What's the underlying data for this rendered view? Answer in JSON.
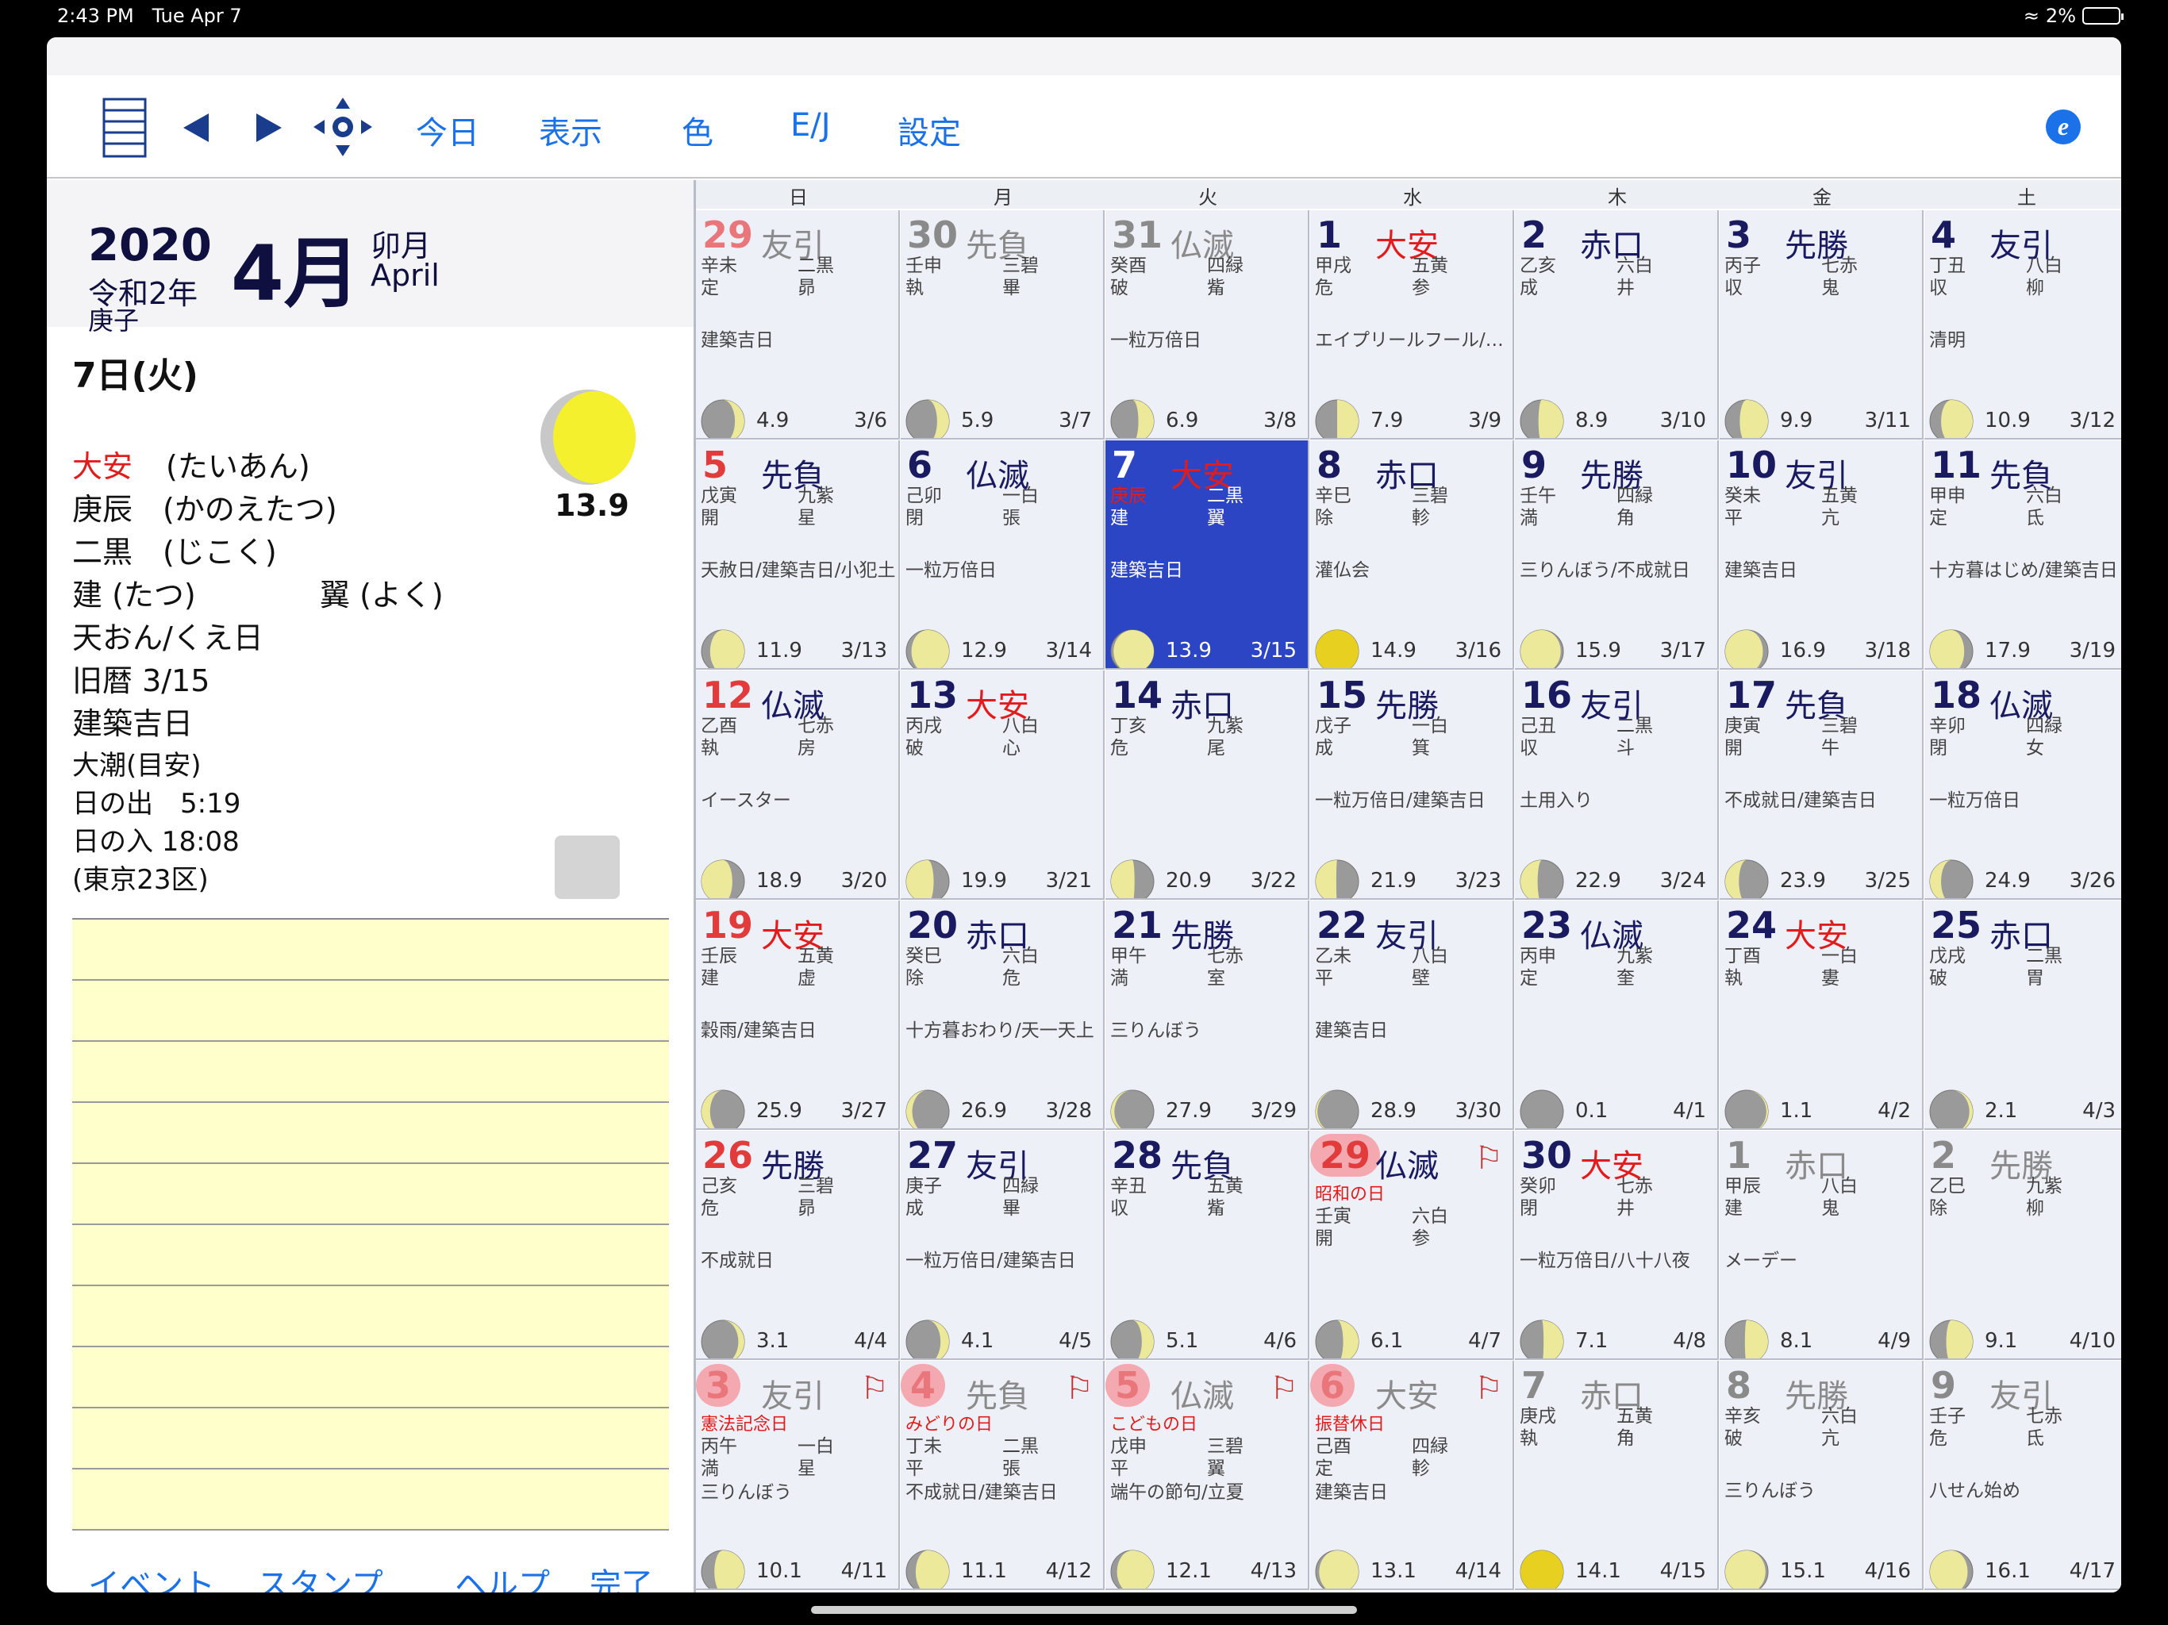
{
  "status": {
    "time": "2:43 PM",
    "date": "Tue Apr 7",
    "battery": "2%"
  },
  "toolbar": {
    "today": "今日",
    "view": "表示",
    "color": "色",
    "ej": "E/J",
    "settings": "設定"
  },
  "header": {
    "year": "2020",
    "reiwa": "令和2年",
    "eto": "庚子",
    "month_num": "4月",
    "month_kan": "卯月",
    "month_eng": "April"
  },
  "detail": {
    "date": "7日(火)",
    "rokuyo": "大安",
    "rokuyo_reading": "(たいあん)",
    "kanshi": "庚辰　(かのえたつ)",
    "kyusei": "二黒　(じこく)",
    "choku": "建 (たつ)",
    "shuku": "翼 (よく)",
    "day_note": "天おん/くえ日",
    "lunar": "旧暦 3/15",
    "kichi": "建築吉日",
    "tide": "大潮(目安)",
    "sunrise": "日の出　5:19",
    "sunset": "日の入 18:08",
    "location": "(東京23区)",
    "moon_age": "13.9"
  },
  "bottom": {
    "event": "イベント",
    "stamp": "スタンプ",
    "help": "ヘルプ",
    "done": "完了"
  },
  "weekdays": [
    "日",
    "月",
    "火",
    "水",
    "木",
    "金",
    "土"
  ],
  "cells": [
    {
      "d": "29",
      "k": "友引",
      "a": "辛未",
      "b": "二黒",
      "c": "定",
      "e": "昴",
      "ev": "建築吉日",
      "age": "4.9",
      "lun": "3/6",
      "o": 1,
      "p": 0.22
    },
    {
      "d": "30",
      "k": "先負",
      "a": "壬申",
      "b": "三碧",
      "c": "執",
      "e": "畢",
      "ev": "",
      "age": "5.9",
      "lun": "3/7",
      "o": 1,
      "p": 0.28
    },
    {
      "d": "31",
      "k": "仏滅",
      "a": "癸酉",
      "b": "四緑",
      "c": "破",
      "e": "觜",
      "ev": "一粒万倍日",
      "age": "6.9",
      "lun": "3/8",
      "o": 1,
      "p": 0.36
    },
    {
      "d": "1",
      "k": "大安",
      "kr": 1,
      "a": "甲戌",
      "b": "五黄",
      "c": "危",
      "e": "参",
      "ev": "エイプリールフール/一粒万倍日",
      "age": "7.9",
      "lun": "3/9",
      "p": 0.5
    },
    {
      "d": "2",
      "k": "赤口",
      "a": "乙亥",
      "b": "六白",
      "c": "成",
      "e": "井",
      "ev": "",
      "age": "8.9",
      "lun": "3/10",
      "p": 0.58
    },
    {
      "d": "3",
      "k": "先勝",
      "a": "丙子",
      "b": "七赤",
      "c": "収",
      "e": "鬼",
      "ev": "",
      "age": "9.9",
      "lun": "3/11",
      "p": 0.66
    },
    {
      "d": "4",
      "k": "友引",
      "a": "丁丑",
      "b": "八白",
      "c": "収",
      "e": "柳",
      "ev": "清明",
      "age": "10.9",
      "lun": "3/12",
      "p": 0.74
    },
    {
      "d": "5",
      "k": "先負",
      "a": "戊寅",
      "b": "九紫",
      "c": "開",
      "e": "星",
      "ev": "天赦日/建築吉日/小犯土",
      "age": "11.9",
      "lun": "3/13",
      "p": 0.8
    },
    {
      "d": "6",
      "k": "仏滅",
      "a": "己卯",
      "b": "一白",
      "c": "閉",
      "e": "張",
      "ev": "一粒万倍日",
      "age": "12.9",
      "lun": "3/14",
      "p": 0.88
    },
    {
      "d": "7",
      "k": "大安",
      "kr": 1,
      "a": "庚辰",
      "b": "二黒",
      "c": "建",
      "e": "翼",
      "ev": "建築吉日",
      "age": "13.9",
      "lun": "3/15",
      "sel": 1,
      "p": 0.94
    },
    {
      "d": "8",
      "k": "赤口",
      "a": "辛巳",
      "b": "三碧",
      "c": "除",
      "e": "軫",
      "ev": "灌仏会",
      "age": "14.9",
      "lun": "3/16",
      "p": 1.0
    },
    {
      "d": "9",
      "k": "先勝",
      "a": "壬午",
      "b": "四緑",
      "c": "満",
      "e": "角",
      "ev": "三りんぼう/不成就日",
      "age": "15.9",
      "lun": "3/17",
      "p": 0.94,
      "w": 1
    },
    {
      "d": "10",
      "k": "友引",
      "a": "癸未",
      "b": "五黄",
      "c": "平",
      "e": "亢",
      "ev": "建築吉日",
      "age": "16.9",
      "lun": "3/18",
      "p": 0.88,
      "w": 1
    },
    {
      "d": "11",
      "k": "先負",
      "a": "甲申",
      "b": "六白",
      "c": "定",
      "e": "氐",
      "ev": "十方暮はじめ/建築吉日",
      "age": "17.9",
      "lun": "3/19",
      "p": 0.8,
      "w": 1
    },
    {
      "d": "12",
      "k": "仏滅",
      "a": "乙酉",
      "b": "七赤",
      "c": "執",
      "e": "房",
      "ev": "イースター",
      "age": "18.9",
      "lun": "3/20",
      "p": 0.72,
      "w": 1
    },
    {
      "d": "13",
      "k": "大安",
      "kr": 1,
      "a": "丙戌",
      "b": "八白",
      "c": "破",
      "e": "心",
      "ev": "",
      "age": "19.9",
      "lun": "3/21",
      "p": 0.64,
      "w": 1
    },
    {
      "d": "14",
      "k": "赤口",
      "a": "丁亥",
      "b": "九紫",
      "c": "危",
      "e": "尾",
      "ev": "",
      "age": "20.9",
      "lun": "3/22",
      "p": 0.55,
      "w": 1
    },
    {
      "d": "15",
      "k": "先勝",
      "a": "戊子",
      "b": "一白",
      "c": "成",
      "e": "箕",
      "ev": "一粒万倍日/建築吉日",
      "age": "21.9",
      "lun": "3/23",
      "p": 0.48,
      "w": 1
    },
    {
      "d": "16",
      "k": "友引",
      "a": "己丑",
      "b": "二黒",
      "c": "収",
      "e": "斗",
      "ev": "土用入り",
      "age": "22.9",
      "lun": "3/24",
      "p": 0.4,
      "w": 1
    },
    {
      "d": "17",
      "k": "先負",
      "a": "庚寅",
      "b": "三碧",
      "c": "開",
      "e": "牛",
      "ev": "不成就日/建築吉日",
      "age": "23.9",
      "lun": "3/25",
      "p": 0.32,
      "w": 1
    },
    {
      "d": "18",
      "k": "仏滅",
      "a": "辛卯",
      "b": "四緑",
      "c": "閉",
      "e": "女",
      "ev": "一粒万倍日",
      "age": "24.9",
      "lun": "3/26",
      "p": 0.26,
      "w": 1
    },
    {
      "d": "19",
      "k": "大安",
      "kr": 1,
      "a": "壬辰",
      "b": "五黄",
      "c": "建",
      "e": "虚",
      "ev": "穀雨/建築吉日",
      "age": "25.9",
      "lun": "3/27",
      "p": 0.2,
      "w": 1
    },
    {
      "d": "20",
      "k": "赤口",
      "a": "癸巳",
      "b": "六白",
      "c": "除",
      "e": "危",
      "ev": "十方暮おわり/天一天上",
      "age": "26.9",
      "lun": "3/28",
      "p": 0.14,
      "w": 1
    },
    {
      "d": "21",
      "k": "先勝",
      "a": "甲午",
      "b": "七赤",
      "c": "満",
      "e": "室",
      "ev": "三りんぼう",
      "age": "27.9",
      "lun": "3/29",
      "p": 0.08,
      "w": 1
    },
    {
      "d": "22",
      "k": "友引",
      "a": "乙未",
      "b": "八白",
      "c": "平",
      "e": "壁",
      "ev": "建築吉日",
      "age": "28.9",
      "lun": "3/30",
      "p": 0.04,
      "w": 1
    },
    {
      "d": "23",
      "k": "仏滅",
      "a": "丙申",
      "b": "九紫",
      "c": "定",
      "e": "奎",
      "ev": "",
      "age": "0.1",
      "lun": "4/1",
      "p": 0.0
    },
    {
      "d": "24",
      "k": "大安",
      "kr": 1,
      "a": "丁酉",
      "b": "一白",
      "c": "執",
      "e": "婁",
      "ev": "",
      "age": "1.1",
      "lun": "4/2",
      "p": 0.04
    },
    {
      "d": "25",
      "k": "赤口",
      "a": "戊戌",
      "b": "二黒",
      "c": "破",
      "e": "胃",
      "ev": "",
      "age": "2.1",
      "lun": "4/3",
      "p": 0.08
    },
    {
      "d": "26",
      "k": "先勝",
      "a": "己亥",
      "b": "三碧",
      "c": "危",
      "e": "昴",
      "ev": "不成就日",
      "age": "3.1",
      "lun": "4/4",
      "p": 0.14
    },
    {
      "d": "27",
      "k": "友引",
      "a": "庚子",
      "b": "四緑",
      "c": "成",
      "e": "畢",
      "ev": "一粒万倍日/建築吉日",
      "age": "4.1",
      "lun": "4/5",
      "p": 0.2
    },
    {
      "d": "28",
      "k": "先負",
      "a": "辛丑",
      "b": "五黄",
      "c": "収",
      "e": "觜",
      "ev": "",
      "age": "5.1",
      "lun": "4/6",
      "p": 0.28
    },
    {
      "d": "29",
      "k": "仏滅",
      "h": "昭和の日",
      "a": "壬寅",
      "b": "六白",
      "c": "開",
      "e": "参",
      "ev": "",
      "age": "6.1",
      "lun": "4/7",
      "hol": 1,
      "p": 0.36
    },
    {
      "d": "30",
      "k": "大安",
      "kr": 1,
      "a": "癸卯",
      "b": "七赤",
      "c": "閉",
      "e": "井",
      "ev": "一粒万倍日/八十八夜",
      "age": "7.1",
      "lun": "4/8",
      "p": 0.46
    },
    {
      "d": "1",
      "k": "赤口",
      "a": "甲辰",
      "b": "八白",
      "c": "建",
      "e": "鬼",
      "ev": "メーデー",
      "age": "8.1",
      "lun": "4/9",
      "o": 1,
      "p": 0.54
    },
    {
      "d": "2",
      "k": "先勝",
      "a": "乙巳",
      "b": "九紫",
      "c": "除",
      "e": "柳",
      "ev": "",
      "age": "9.1",
      "lun": "4/10",
      "o": 1,
      "p": 0.62
    },
    {
      "d": "3",
      "k": "友引",
      "h": "憲法記念日",
      "a": "丙午",
      "b": "一白",
      "c": "満",
      "e": "星",
      "ev": "三りんぼう",
      "age": "10.1",
      "lun": "4/11",
      "o": 1,
      "hol": 1,
      "p": 0.7
    },
    {
      "d": "4",
      "k": "先負",
      "h": "みどりの日",
      "a": "丁未",
      "b": "二黒",
      "c": "平",
      "e": "張",
      "ev": "不成就日/建築吉日",
      "age": "11.1",
      "lun": "4/12",
      "o": 1,
      "hol": 1,
      "p": 0.78
    },
    {
      "d": "5",
      "k": "仏滅",
      "h": "こどもの日",
      "a": "戊申",
      "b": "三碧",
      "c": "平",
      "e": "翼",
      "ev": "端午の節句/立夏",
      "age": "12.1",
      "lun": "4/13",
      "o": 1,
      "hol": 1,
      "p": 0.86
    },
    {
      "d": "6",
      "k": "大安",
      "kr": 1,
      "h": "振替休日",
      "a": "己酉",
      "b": "四緑",
      "c": "定",
      "e": "軫",
      "ev": "建築吉日",
      "age": "13.1",
      "lun": "4/14",
      "o": 1,
      "hol": 1,
      "p": 0.92
    },
    {
      "d": "7",
      "k": "赤口",
      "a": "庚戌",
      "b": "五黄",
      "c": "執",
      "e": "角",
      "ev": "",
      "age": "14.1",
      "lun": "4/15",
      "o": 1,
      "p": 1.0
    },
    {
      "d": "8",
      "k": "先勝",
      "a": "辛亥",
      "b": "六白",
      "c": "破",
      "e": "亢",
      "ev": "三りんぼう",
      "age": "15.1",
      "lun": "4/16",
      "o": 1,
      "p": 0.94,
      "w": 1
    },
    {
      "d": "9",
      "k": "友引",
      "a": "壬子",
      "b": "七赤",
      "c": "危",
      "e": "氐",
      "ev": "八せん始め",
      "age": "16.1",
      "lun": "4/17",
      "o": 1,
      "p": 0.88,
      "w": 1
    }
  ]
}
